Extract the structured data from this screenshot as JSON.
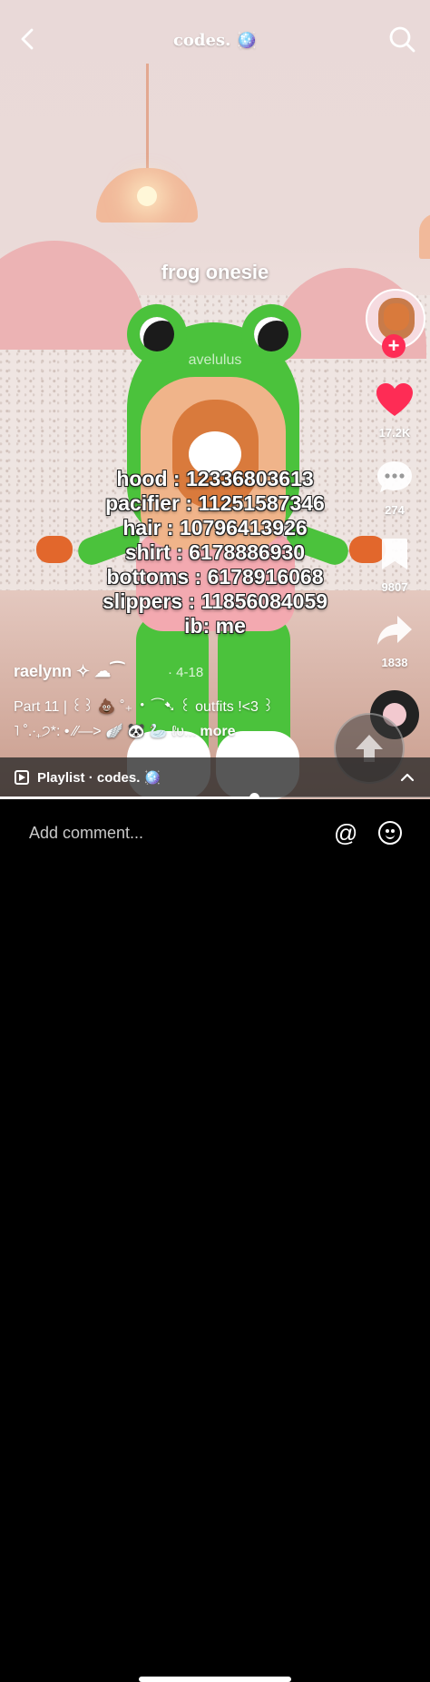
{
  "header": {
    "title": "codes. 🪩",
    "back_icon": "chevron-left-icon",
    "search_icon": "search-icon"
  },
  "video": {
    "caption": "frog onesie",
    "watermark": "avelulus",
    "codes": [
      "hood : 12336803613",
      "pacifier : 11251587346",
      "hair : 10796413926",
      "shirt : 6178886930",
      "bottoms : 6178916068",
      "slippers : 11856084059",
      "ib: me"
    ]
  },
  "rail": {
    "likes": "17.2K",
    "comments": "274",
    "saves": "9807",
    "shares": "1838",
    "like_color": "#fe2c55",
    "follow_color": "#fe2c55"
  },
  "post": {
    "author": "raelynn ✧ ☁⁀",
    "date": "· 4-18",
    "description_line1": "Part 11 | ꒰꒱ 💩 ˚₊ ‧ ⁀➷ ꒰ outfits !<3 ꒱",
    "description_line2": "˥ ˚.‧₊੭*: • ⁄⁄—> 🪽 🐼 🦢 ℓυ...",
    "more": "more"
  },
  "playlist": {
    "label": "Playlist · codes. 🪩"
  },
  "playback": {
    "progress": 0.59
  },
  "comment_bar": {
    "placeholder": "Add comment...",
    "mention_icon": "at-icon",
    "emoji_icon": "emoji-icon"
  }
}
